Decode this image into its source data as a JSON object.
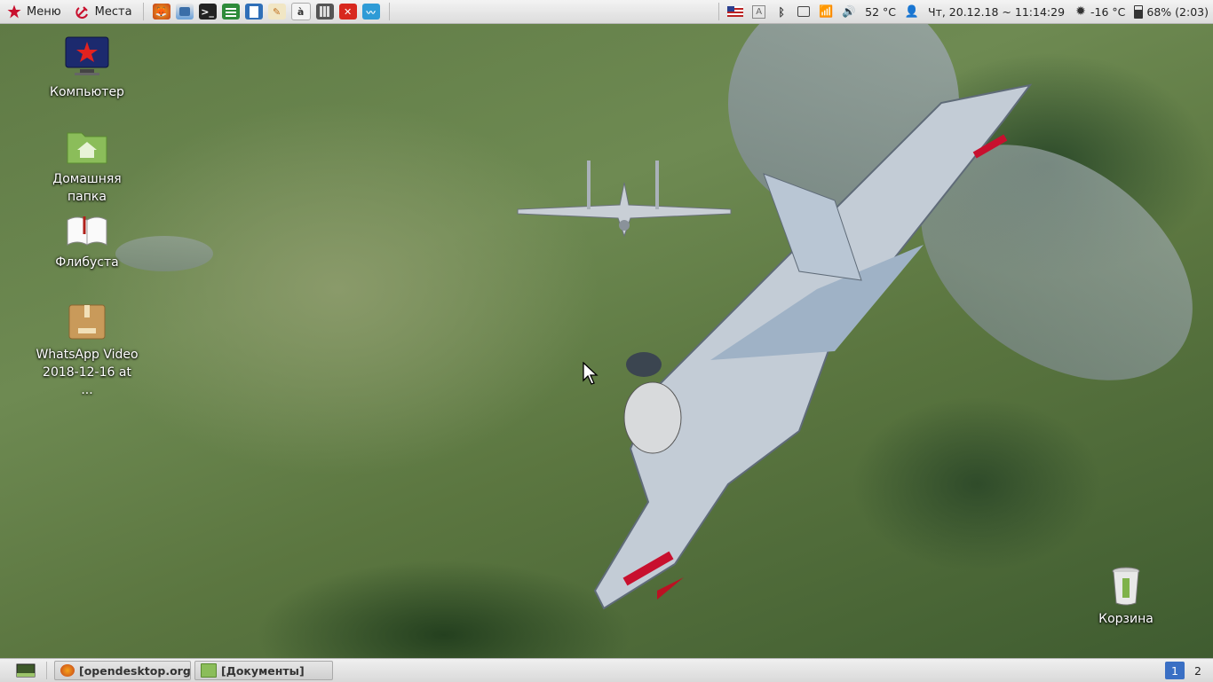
{
  "top_panel": {
    "menu_label": "Меню",
    "places_label": "Места",
    "launchers": [
      {
        "name": "firefox-launcher",
        "icon": "firefox-icon"
      },
      {
        "name": "files-launcher",
        "icon": "file-manager-icon"
      },
      {
        "name": "terminal-launcher",
        "icon": "terminal-icon"
      },
      {
        "name": "spreadsheet-launcher",
        "icon": "spreadsheet-icon"
      },
      {
        "name": "writer-launcher",
        "icon": "document-icon"
      },
      {
        "name": "text-editor-launcher",
        "icon": "text-editor-icon"
      },
      {
        "name": "dictionary-launcher",
        "icon": "dictionary-icon"
      },
      {
        "name": "calculator-launcher",
        "icon": "calculator-icon"
      },
      {
        "name": "app-x-launcher",
        "icon": "x-app-icon"
      },
      {
        "name": "system-monitor-launcher",
        "icon": "system-monitor-icon"
      }
    ],
    "tray": {
      "cpu_temp": "52 °C",
      "datetime": "Чт, 20.12.18 ~ 11:14:29",
      "weather": "-16 °C",
      "battery": "68% (2:03)"
    }
  },
  "desktop": {
    "icons": [
      {
        "label": "Компьютер",
        "icon": "computer-icon"
      },
      {
        "label": "Домашняя папка",
        "icon": "home-folder-icon"
      },
      {
        "label": "Флибуста",
        "icon": "book-icon"
      },
      {
        "label": "WhatsApp Video 2018-12-16 at ...",
        "icon": "package-icon"
      },
      {
        "label": "Корзина",
        "icon": "trash-icon"
      }
    ]
  },
  "taskbar": {
    "tasks": [
      {
        "label": "[opendesktop.org - ...",
        "icon": "firefox-icon"
      },
      {
        "label": "[Документы]",
        "icon": "folder-icon"
      }
    ],
    "workspaces": [
      "1",
      "2"
    ],
    "active_workspace": "1"
  },
  "colors": {
    "panel": "#e4e4e4",
    "workspace_active": "#3a6fc4",
    "menu_star": "#c8102e"
  }
}
